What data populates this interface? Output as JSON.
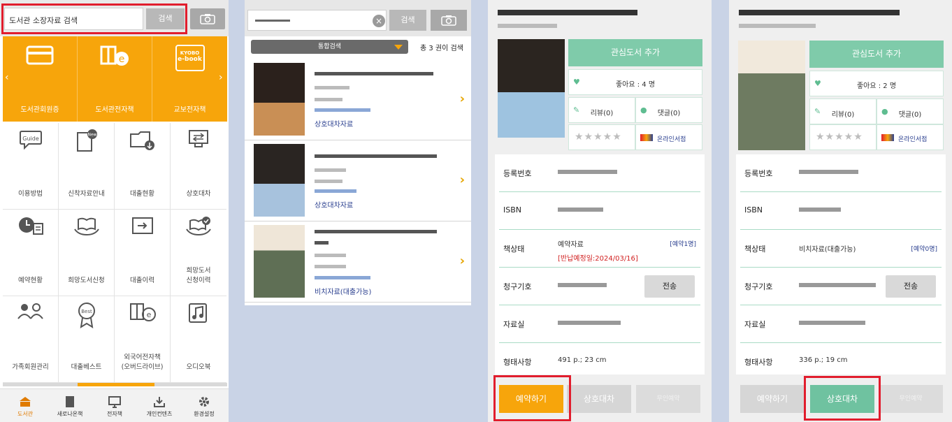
{
  "panel1": {
    "search_placeholder": "도서관 소장자료 검색",
    "search_button": "검색",
    "top_tiles": [
      {
        "label": "도서관회원증",
        "icon": "card-icon"
      },
      {
        "label": "도서관전자책",
        "icon": "ebook-icon"
      },
      {
        "label": "교보전자책",
        "icon": "kyobo-ebook-icon",
        "logo_top": "KYOBO",
        "logo_bottom": "e-book"
      }
    ],
    "grid_items": [
      {
        "label": "이용방법",
        "icon": "guide-icon",
        "badge": "Guide"
      },
      {
        "label": "신착자료안내",
        "icon": "new-book-icon",
        "badge": "New"
      },
      {
        "label": "대출현황",
        "icon": "loan-status-icon"
      },
      {
        "label": "상호대차",
        "icon": "interlibrary-loan-icon"
      },
      {
        "label": "예약현황",
        "icon": "reservation-icon"
      },
      {
        "label": "희망도서신청",
        "icon": "wish-book-icon"
      },
      {
        "label": "대출이력",
        "icon": "loan-history-icon"
      },
      {
        "label": "희망도서\n신청이력",
        "icon": "wish-history-icon"
      },
      {
        "label": "가족회원관리",
        "icon": "family-member-icon"
      },
      {
        "label": "대출베스트",
        "icon": "best-icon",
        "badge": "Best"
      },
      {
        "label": "외국어전자책\n(오버드라이브)",
        "icon": "foreign-ebook-icon"
      },
      {
        "label": "오디오북",
        "icon": "audiobook-icon"
      }
    ],
    "tabs": [
      {
        "label": "도서관",
        "icon": "library-icon",
        "active": true
      },
      {
        "label": "새로나온책",
        "icon": "new-books-icon"
      },
      {
        "label": "전자책",
        "icon": "monitor-icon"
      },
      {
        "label": "개인컨텐츠",
        "icon": "download-icon"
      },
      {
        "label": "환경설정",
        "icon": "gear-icon"
      }
    ],
    "accent_color": "#f7a50b"
  },
  "panel2": {
    "search_button": "검색",
    "filter_label": "통합검색",
    "result_count": "총 3 권이 검색",
    "results": [
      {
        "status": "상호대차자료"
      },
      {
        "status": "상호대차자료"
      },
      {
        "status": "비치자료(대출가능)"
      }
    ]
  },
  "panel3": {
    "add_interest": "관심도서 추가",
    "likes": "좋아요 : 4 명",
    "review": "리뷰(0)",
    "comment": "댓글(0)",
    "stars": "★★★★★",
    "online_shop": "온라인서점",
    "info": {
      "reg_no_label": "등록번호",
      "isbn_label": "ISBN",
      "status_label": "책상태",
      "status_value": "예약자료",
      "reserve_count": "[예약1명]",
      "due_date": "[반납예정일:2024/03/16]",
      "call_no_label": "청구기호",
      "transfer_button": "전송",
      "room_label": "자료실",
      "form_label": "형태사항",
      "form_value": "491 p.; 23 cm"
    },
    "buttons": {
      "reserve": "예약하기",
      "interloan": "상호대차",
      "unmanned": "무인예약"
    }
  },
  "panel4": {
    "add_interest": "관심도서 추가",
    "likes": "좋아요 : 2 명",
    "review": "리뷰(0)",
    "comment": "댓글(0)",
    "stars": "★★★★★",
    "online_shop": "온라인서점",
    "info": {
      "reg_no_label": "등록번호",
      "isbn_label": "ISBN",
      "status_label": "책상태",
      "status_value": "비치자료(대출가능)",
      "reserve_count": "[예약0명]",
      "call_no_label": "청구기호",
      "transfer_button": "전송",
      "room_label": "자료실",
      "form_label": "형태사항",
      "form_value": "336 p.; 19 cm"
    },
    "buttons": {
      "reserve": "예약하기",
      "interloan": "상호대차",
      "unmanned": "무인예약"
    }
  }
}
